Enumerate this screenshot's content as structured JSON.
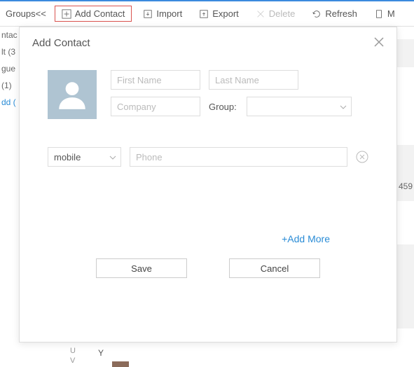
{
  "toolbar": {
    "groups_label": "Groups<<",
    "add_contact": "Add Contact",
    "import": "Import",
    "export": "Export",
    "delete": "Delete",
    "refresh": "Refresh",
    "m": "M"
  },
  "sidebar": {
    "items": [
      "ntac",
      "lt (3",
      "gue",
      " (1)"
    ],
    "add_link": "dd ("
  },
  "modal": {
    "title": "Add Contact",
    "first_name_ph": "First Name",
    "last_name_ph": "Last Name",
    "company_ph": "Company",
    "group_label": "Group:",
    "type_value": "mobile",
    "phone_ph": "Phone",
    "add_more": "+Add More",
    "save": "Save",
    "cancel": "Cancel"
  },
  "letters": [
    "U",
    "V",
    "Y"
  ],
  "bg_number": "459"
}
